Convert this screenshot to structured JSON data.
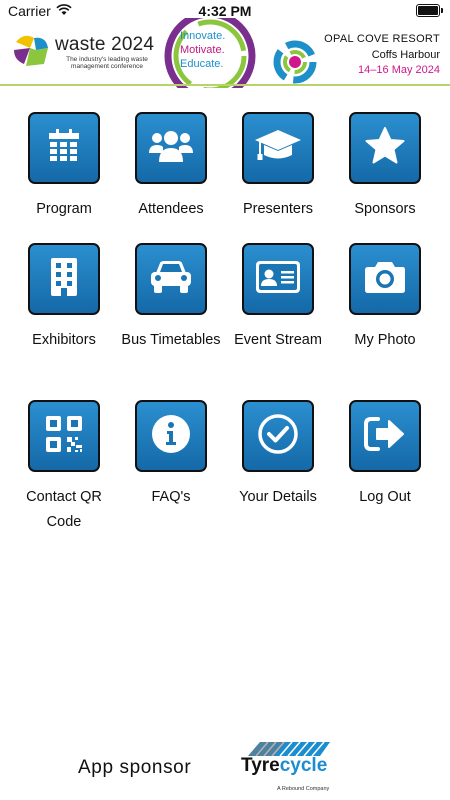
{
  "status_bar": {
    "carrier": "Carrier",
    "time": "4:32 PM"
  },
  "banner": {
    "brand": "waste 2024",
    "tagline": "The industry's leading waste management conference",
    "slogan": [
      "Innovate.",
      "Motivate.",
      "Educate."
    ],
    "venue": "OPAL COVE RESORT",
    "city": "Coffs Harbour",
    "dates": "14–16 May 2024",
    "colors": {
      "blue": "#1d8fc9",
      "magenta": "#c2187d",
      "green": "#b9d36a"
    }
  },
  "menu": [
    {
      "label": "Program",
      "icon": "calendar-icon"
    },
    {
      "label": "Attendees",
      "icon": "people-icon"
    },
    {
      "label": "Presenters",
      "icon": "graduation-cap-icon"
    },
    {
      "label": "Sponsors",
      "icon": "star-icon"
    },
    {
      "label": "Exhibitors",
      "icon": "building-icon"
    },
    {
      "label": "Bus Timetables",
      "icon": "car-icon"
    },
    {
      "label": "Event Stream",
      "icon": "id-card-icon"
    },
    {
      "label": "My Photo",
      "icon": "camera-icon"
    },
    {
      "label": "Contact QR Code",
      "icon": "qr-code-icon"
    },
    {
      "label": "FAQ's",
      "icon": "info-icon"
    },
    {
      "label": "Your Details",
      "icon": "check-circle-icon"
    },
    {
      "label": "Log Out",
      "icon": "logout-icon"
    }
  ],
  "footer": {
    "sponsor_label": "App sponsor",
    "sponsor_name_a": "Tyre",
    "sponsor_name_b": "cycle",
    "sponsor_sub": "A Rebound Company"
  },
  "theme": {
    "tile_top": "#2b8fcf",
    "tile_bottom": "#1569a8"
  }
}
